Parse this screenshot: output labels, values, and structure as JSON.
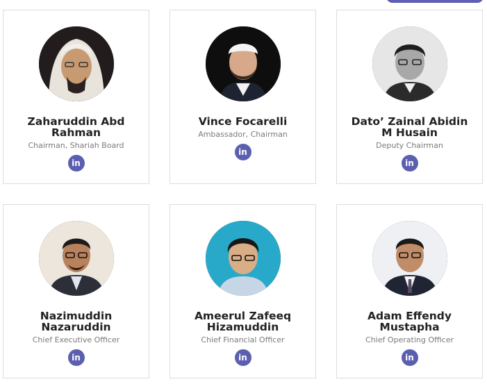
{
  "team": [
    {
      "name": "Zaharuddin Abd Rahman",
      "role": "Chairman, Shariah Board",
      "social": "in",
      "avatar_bg": "#231c1c"
    },
    {
      "name": "Vince Focarelli",
      "role": "Ambassador, Chairman",
      "social": "in",
      "avatar_bg": "#0e0e0e"
    },
    {
      "name": "Dato’ Zainal Abidin M Husain",
      "role": "Deputy Chairman",
      "social": "in",
      "avatar_bg": "#e6e6e6"
    },
    {
      "name": "Nazimuddin Nazaruddin",
      "role": "Chief Executive Officer",
      "social": "in",
      "avatar_bg": "#ece6dc"
    },
    {
      "name": "Ameerul Zafeeq Hizamuddin",
      "role": "Chief Financial Officer",
      "social": "in",
      "avatar_bg": "#29a9c9"
    },
    {
      "name": "Adam Effendy Mustapha",
      "role": "Chief Operating Officer",
      "social": "in",
      "avatar_bg": "#eef0f4"
    }
  ],
  "colors": {
    "linkedin": "#5b5fb0",
    "card_border": "#dcdcdc"
  }
}
